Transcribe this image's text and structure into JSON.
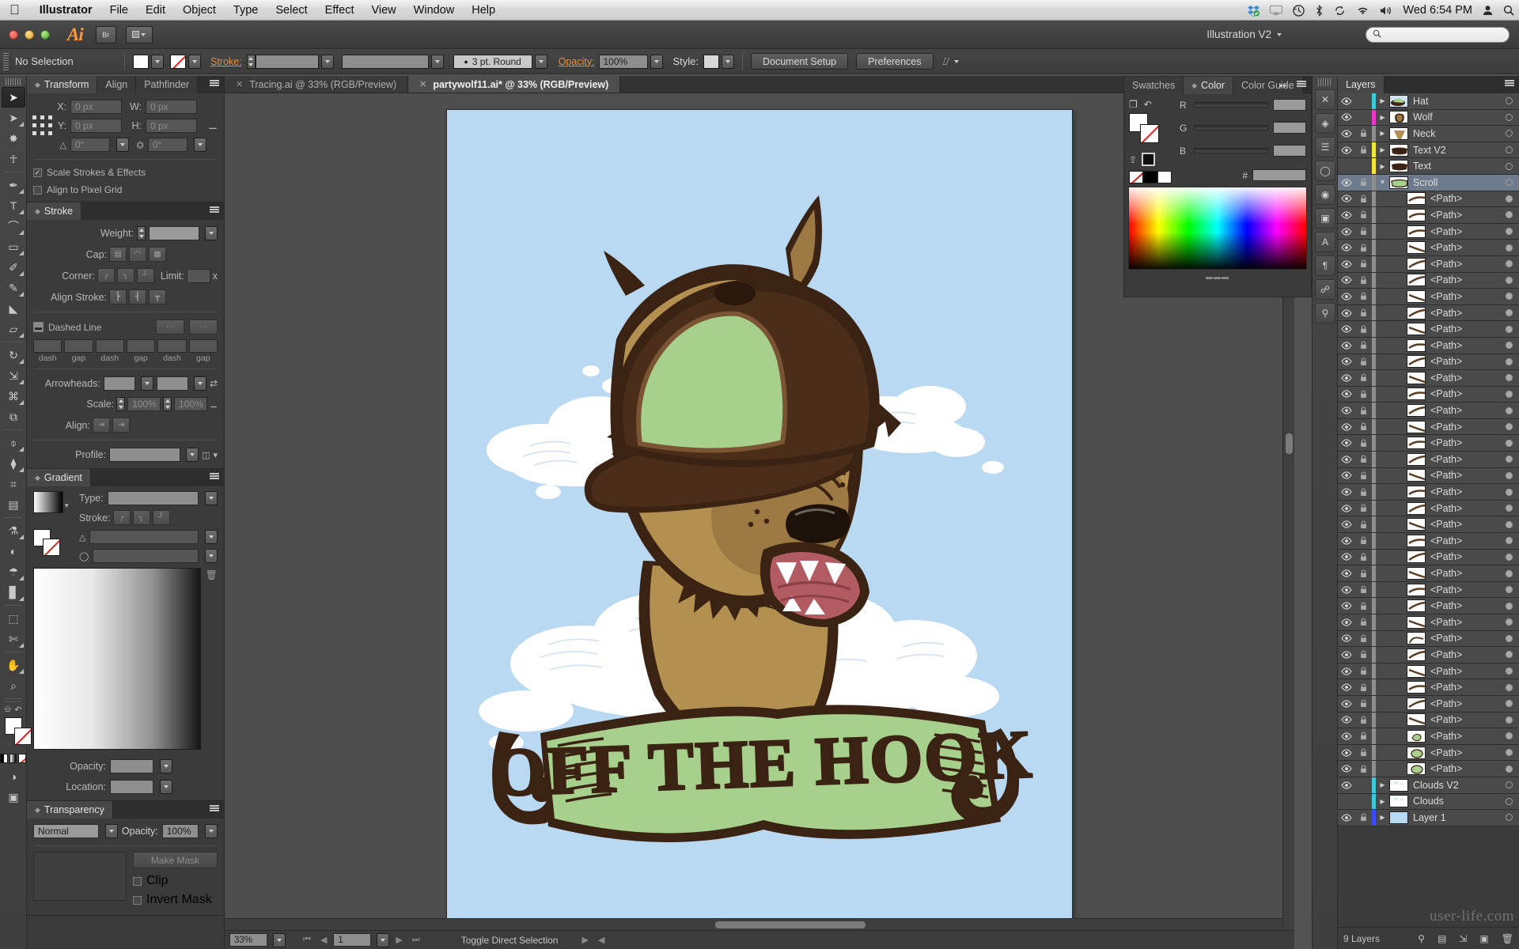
{
  "macbar": {
    "apple_icon": "apple-icon",
    "menus": [
      "Illustrator",
      "File",
      "Edit",
      "Object",
      "Type",
      "Select",
      "Effect",
      "View",
      "Window",
      "Help"
    ],
    "status_icons": [
      "dropbox-icon",
      "airplay-icon",
      "timemachine-icon",
      "bluetooth-icon",
      "sync-icon",
      "wifi-icon",
      "volume-icon"
    ],
    "clock": "Wed 6:54 PM",
    "user_icon": "user-icon",
    "search_icon": "spotlight-search-icon"
  },
  "titlebar": {
    "app_logo": "Ai",
    "bridge_label": "Br",
    "arrange_label": "arrange-documents",
    "workspace": "Illustration V2",
    "search_placeholder": "",
    "search_icon": "search-icon"
  },
  "controlbar": {
    "selection_status": "No Selection",
    "fill_swatch": "#ffffff",
    "stroke_swatch": "none",
    "stroke_label": "Stroke:",
    "stroke_weight": "",
    "stroke_profile": "",
    "brush_definition": "3 pt. Round",
    "opacity_label": "Opacity:",
    "opacity_value": "100%",
    "style_label": "Style:",
    "document_setup": "Document Setup",
    "preferences": "Preferences"
  },
  "toolbar": {
    "tools": [
      {
        "name": "selection-tool",
        "glyph": "➤",
        "selected": true,
        "flyout": false
      },
      {
        "name": "direct-selection-tool",
        "glyph": "➤",
        "selected": false,
        "flyout": true
      },
      {
        "name": "magic-wand-tool",
        "glyph": "✸",
        "selected": false,
        "flyout": false
      },
      {
        "name": "lasso-tool",
        "glyph": "☥",
        "selected": false,
        "flyout": false
      },
      {
        "name": "pen-tool",
        "glyph": "✒",
        "selected": false,
        "flyout": true
      },
      {
        "name": "type-tool",
        "glyph": "T",
        "selected": false,
        "flyout": true
      },
      {
        "name": "line-segment-tool",
        "glyph": "⌒",
        "selected": false,
        "flyout": true
      },
      {
        "name": "rectangle-tool",
        "glyph": "▭",
        "selected": false,
        "flyout": true
      },
      {
        "name": "paintbrush-tool",
        "glyph": "✐",
        "selected": false,
        "flyout": true
      },
      {
        "name": "pencil-tool",
        "glyph": "✎",
        "selected": false,
        "flyout": true
      },
      {
        "name": "blob-brush-tool",
        "glyph": "◣",
        "selected": false,
        "flyout": false
      },
      {
        "name": "eraser-tool",
        "glyph": "▱",
        "selected": false,
        "flyout": true
      },
      {
        "name": "rotate-tool",
        "glyph": "↻",
        "selected": false,
        "flyout": true
      },
      {
        "name": "scale-tool",
        "glyph": "⇲",
        "selected": false,
        "flyout": true
      },
      {
        "name": "width-tool",
        "glyph": "⌘",
        "selected": false,
        "flyout": true
      },
      {
        "name": "free-transform-tool",
        "glyph": "⧉",
        "selected": false,
        "flyout": false
      },
      {
        "name": "shape-builder-tool",
        "glyph": "⌽",
        "selected": false,
        "flyout": true
      },
      {
        "name": "perspective-grid-tool",
        "glyph": "⧫",
        "selected": false,
        "flyout": true
      },
      {
        "name": "mesh-tool",
        "glyph": "⌗",
        "selected": false,
        "flyout": false
      },
      {
        "name": "gradient-tool",
        "glyph": "▤",
        "selected": false,
        "flyout": false
      },
      {
        "name": "eyedropper-tool",
        "glyph": "⚗",
        "selected": false,
        "flyout": true
      },
      {
        "name": "blend-tool",
        "glyph": "◐",
        "selected": false,
        "flyout": false
      },
      {
        "name": "symbol-sprayer-tool",
        "glyph": "☂",
        "selected": false,
        "flyout": true
      },
      {
        "name": "column-graph-tool",
        "glyph": "▊",
        "selected": false,
        "flyout": true
      },
      {
        "name": "artboard-tool",
        "glyph": "⬚",
        "selected": false,
        "flyout": false
      },
      {
        "name": "slice-tool",
        "glyph": "✄",
        "selected": false,
        "flyout": true
      },
      {
        "name": "hand-tool",
        "glyph": "✋",
        "selected": false,
        "flyout": true
      },
      {
        "name": "zoom-tool",
        "glyph": "⌕",
        "selected": false,
        "flyout": false
      }
    ]
  },
  "transform_panel": {
    "tabs": [
      "Transform",
      "Align",
      "Pathfinder"
    ],
    "active_tab": "Transform",
    "x_label": "X:",
    "x_value": "0 px",
    "w_label": "W:",
    "w_value": "0 px",
    "y_label": "Y:",
    "y_value": "0 px",
    "h_label": "H:",
    "h_value": "0 px",
    "rotate_value": "0°",
    "shear_value": "0°",
    "scale_strokes": "Scale Strokes & Effects",
    "scale_strokes_checked": true,
    "align_pixel_grid": "Align to Pixel Grid",
    "align_pixel_grid_checked": false
  },
  "stroke_panel": {
    "title": "Stroke",
    "weight_label": "Weight:",
    "weight_value": "",
    "cap_label": "Cap:",
    "corner_label": "Corner:",
    "limit_label": "Limit:",
    "limit_value": "",
    "limit_unit": "x",
    "align_stroke_label": "Align Stroke:",
    "dashed_line_label": "Dashed Line",
    "dash_gap_labels": [
      "dash",
      "gap",
      "dash",
      "gap",
      "dash",
      "gap"
    ],
    "arrowheads_label": "Arrowheads:",
    "scale_label": "Scale:",
    "scale_value_1": "100%",
    "scale_value_2": "100%",
    "align_label": "Align:",
    "profile_label": "Profile:"
  },
  "gradient_panel": {
    "title": "Gradient",
    "type_label": "Type:",
    "stroke_label": "Stroke:",
    "angle_value": "",
    "aspect_value": "",
    "opacity_label": "Opacity:",
    "location_label": "Location:"
  },
  "transparency_panel": {
    "title": "Transparency",
    "blend_mode": "Normal",
    "opacity_label": "Opacity:",
    "opacity_value": "100%",
    "make_mask": "Make Mask",
    "clip_label": "Clip",
    "invert_mask_label": "Invert Mask"
  },
  "color_panel": {
    "tabs": [
      "Swatches",
      "Color",
      "Color Guide"
    ],
    "active_tab": "Color",
    "channels": [
      "R",
      "G",
      "B"
    ],
    "hex_label": "#",
    "hex_value": "",
    "none_swatch": "none",
    "black_swatch": "#000000",
    "white_swatch": "#ffffff"
  },
  "icon_dock": {
    "icons": [
      "brushes-icon",
      "symbols-icon",
      "stroke-icon",
      "graphic-styles-icon",
      "appearance-icon",
      "transform-icon",
      "character-icon",
      "paragraph-icon",
      "links-icon",
      "navigator-icon"
    ]
  },
  "documents": {
    "tabs": [
      {
        "label": "Tracing.ai @ 33% (RGB/Preview)",
        "active": false,
        "close": "×"
      },
      {
        "label": "partywolf11.ai* @ 33% (RGB/Preview)",
        "active": true,
        "close": "×"
      }
    ]
  },
  "statusbar": {
    "zoom": "33%",
    "page": "1",
    "status_text": "Toggle Direct Selection"
  },
  "layers_panel": {
    "title": "Layers",
    "rows": [
      {
        "name": "Hat",
        "visible": true,
        "locked": false,
        "color": "#3ec9d6",
        "expanded": false,
        "type": "layer",
        "thumb": "hat"
      },
      {
        "name": "Wolf",
        "visible": true,
        "locked": false,
        "color": "#e836c8",
        "expanded": false,
        "type": "layer",
        "thumb": "wolf"
      },
      {
        "name": "Neck",
        "visible": true,
        "locked": true,
        "color": "#8e8e8e",
        "expanded": false,
        "type": "layer",
        "thumb": "neck"
      },
      {
        "name": "Text V2",
        "visible": true,
        "locked": true,
        "color": "#f2e53a",
        "expanded": false,
        "type": "layer",
        "thumb": "text"
      },
      {
        "name": "Text",
        "visible": false,
        "locked": false,
        "color": "#f2e53a",
        "expanded": false,
        "type": "layer",
        "thumb": "text"
      },
      {
        "name": "Scroll",
        "visible": true,
        "locked": true,
        "color": "#8e8e8e",
        "expanded": true,
        "type": "layer",
        "thumb": "scroll",
        "selected": true
      },
      {
        "name": "<Path>",
        "visible": true,
        "locked": true,
        "type": "path",
        "thumb": "stroke1"
      },
      {
        "name": "<Path>",
        "visible": true,
        "locked": true,
        "type": "path",
        "thumb": "stroke1"
      },
      {
        "name": "<Path>",
        "visible": true,
        "locked": true,
        "type": "path",
        "thumb": "stroke1"
      },
      {
        "name": "<Path>",
        "visible": true,
        "locked": true,
        "type": "path",
        "thumb": "stroke2"
      },
      {
        "name": "<Path>",
        "visible": true,
        "locked": true,
        "type": "path",
        "thumb": "stroke3"
      },
      {
        "name": "<Path>",
        "visible": true,
        "locked": true,
        "type": "path",
        "thumb": "stroke3"
      },
      {
        "name": "<Path>",
        "visible": true,
        "locked": true,
        "type": "path",
        "thumb": "stroke2"
      },
      {
        "name": "<Path>",
        "visible": true,
        "locked": true,
        "type": "path",
        "thumb": "stroke3"
      },
      {
        "name": "<Path>",
        "visible": true,
        "locked": true,
        "type": "path",
        "thumb": "stroke2"
      },
      {
        "name": "<Path>",
        "visible": true,
        "locked": true,
        "type": "path",
        "thumb": "stroke1"
      },
      {
        "name": "<Path>",
        "visible": true,
        "locked": true,
        "type": "path",
        "thumb": "stroke3"
      },
      {
        "name": "<Path>",
        "visible": true,
        "locked": true,
        "type": "path",
        "thumb": "stroke2"
      },
      {
        "name": "<Path>",
        "visible": true,
        "locked": true,
        "type": "path",
        "thumb": "stroke1"
      },
      {
        "name": "<Path>",
        "visible": true,
        "locked": true,
        "type": "path",
        "thumb": "stroke3"
      },
      {
        "name": "<Path>",
        "visible": true,
        "locked": true,
        "type": "path",
        "thumb": "stroke2"
      },
      {
        "name": "<Path>",
        "visible": true,
        "locked": true,
        "type": "path",
        "thumb": "stroke1"
      },
      {
        "name": "<Path>",
        "visible": true,
        "locked": true,
        "type": "path",
        "thumb": "stroke3"
      },
      {
        "name": "<Path>",
        "visible": true,
        "locked": true,
        "type": "path",
        "thumb": "stroke2"
      },
      {
        "name": "<Path>",
        "visible": true,
        "locked": true,
        "type": "path",
        "thumb": "stroke1"
      },
      {
        "name": "<Path>",
        "visible": true,
        "locked": true,
        "type": "path",
        "thumb": "stroke3"
      },
      {
        "name": "<Path>",
        "visible": true,
        "locked": true,
        "type": "path",
        "thumb": "stroke2"
      },
      {
        "name": "<Path>",
        "visible": true,
        "locked": true,
        "type": "path",
        "thumb": "stroke1"
      },
      {
        "name": "<Path>",
        "visible": true,
        "locked": true,
        "type": "path",
        "thumb": "stroke3"
      },
      {
        "name": "<Path>",
        "visible": true,
        "locked": true,
        "type": "path",
        "thumb": "stroke2"
      },
      {
        "name": "<Path>",
        "visible": true,
        "locked": true,
        "type": "path",
        "thumb": "stroke1"
      },
      {
        "name": "<Path>",
        "visible": true,
        "locked": true,
        "type": "path",
        "thumb": "stroke3"
      },
      {
        "name": "<Path>",
        "visible": true,
        "locked": true,
        "type": "path",
        "thumb": "stroke2"
      },
      {
        "name": "<Path>",
        "visible": true,
        "locked": true,
        "type": "path",
        "thumb": "curve"
      },
      {
        "name": "<Path>",
        "visible": true,
        "locked": true,
        "type": "path",
        "thumb": "stroke3"
      },
      {
        "name": "<Path>",
        "visible": true,
        "locked": true,
        "type": "path",
        "thumb": "stroke2"
      },
      {
        "name": "<Path>",
        "visible": true,
        "locked": true,
        "type": "path",
        "thumb": "stroke1"
      },
      {
        "name": "<Path>",
        "visible": true,
        "locked": true,
        "type": "path",
        "thumb": "stroke3"
      },
      {
        "name": "<Path>",
        "visible": true,
        "locked": true,
        "type": "path",
        "thumb": "stroke2"
      },
      {
        "name": "<Path>",
        "visible": true,
        "locked": true,
        "type": "path",
        "thumb": "leaf"
      },
      {
        "name": "<Path>",
        "visible": true,
        "locked": true,
        "type": "path",
        "thumb": "green"
      },
      {
        "name": "<Path>",
        "visible": true,
        "locked": true,
        "type": "path",
        "thumb": "green"
      },
      {
        "name": "Clouds V2",
        "visible": true,
        "locked": false,
        "color": "#3ec9d6",
        "expanded": false,
        "type": "layer",
        "thumb": "clouds"
      },
      {
        "name": "Clouds",
        "visible": false,
        "locked": false,
        "color": "#3ec9d6",
        "expanded": false,
        "type": "layer",
        "thumb": "clouds"
      },
      {
        "name": "Layer 1",
        "visible": true,
        "locked": true,
        "color": "#3a4df2",
        "expanded": false,
        "type": "layer",
        "thumb": "sky"
      }
    ],
    "footer_count": "9 Layers",
    "footer_icons": [
      "locate-object-icon",
      "make-clipping-mask-icon",
      "create-sublayer-icon",
      "create-new-layer-icon",
      "delete-selection-icon"
    ]
  },
  "artwork": {
    "banner_text": "OFF THE HOOK",
    "colors": {
      "sky": "#b9d8f2",
      "cloud": "#ffffff",
      "dark_brown": "#3a2313",
      "mid_brown": "#7a5433",
      "fur_light": "#b3904f",
      "fur_mid": "#9c7843",
      "green": "#a8d08d",
      "tongue": "#b35b62"
    }
  },
  "watermark": "user-life.com"
}
